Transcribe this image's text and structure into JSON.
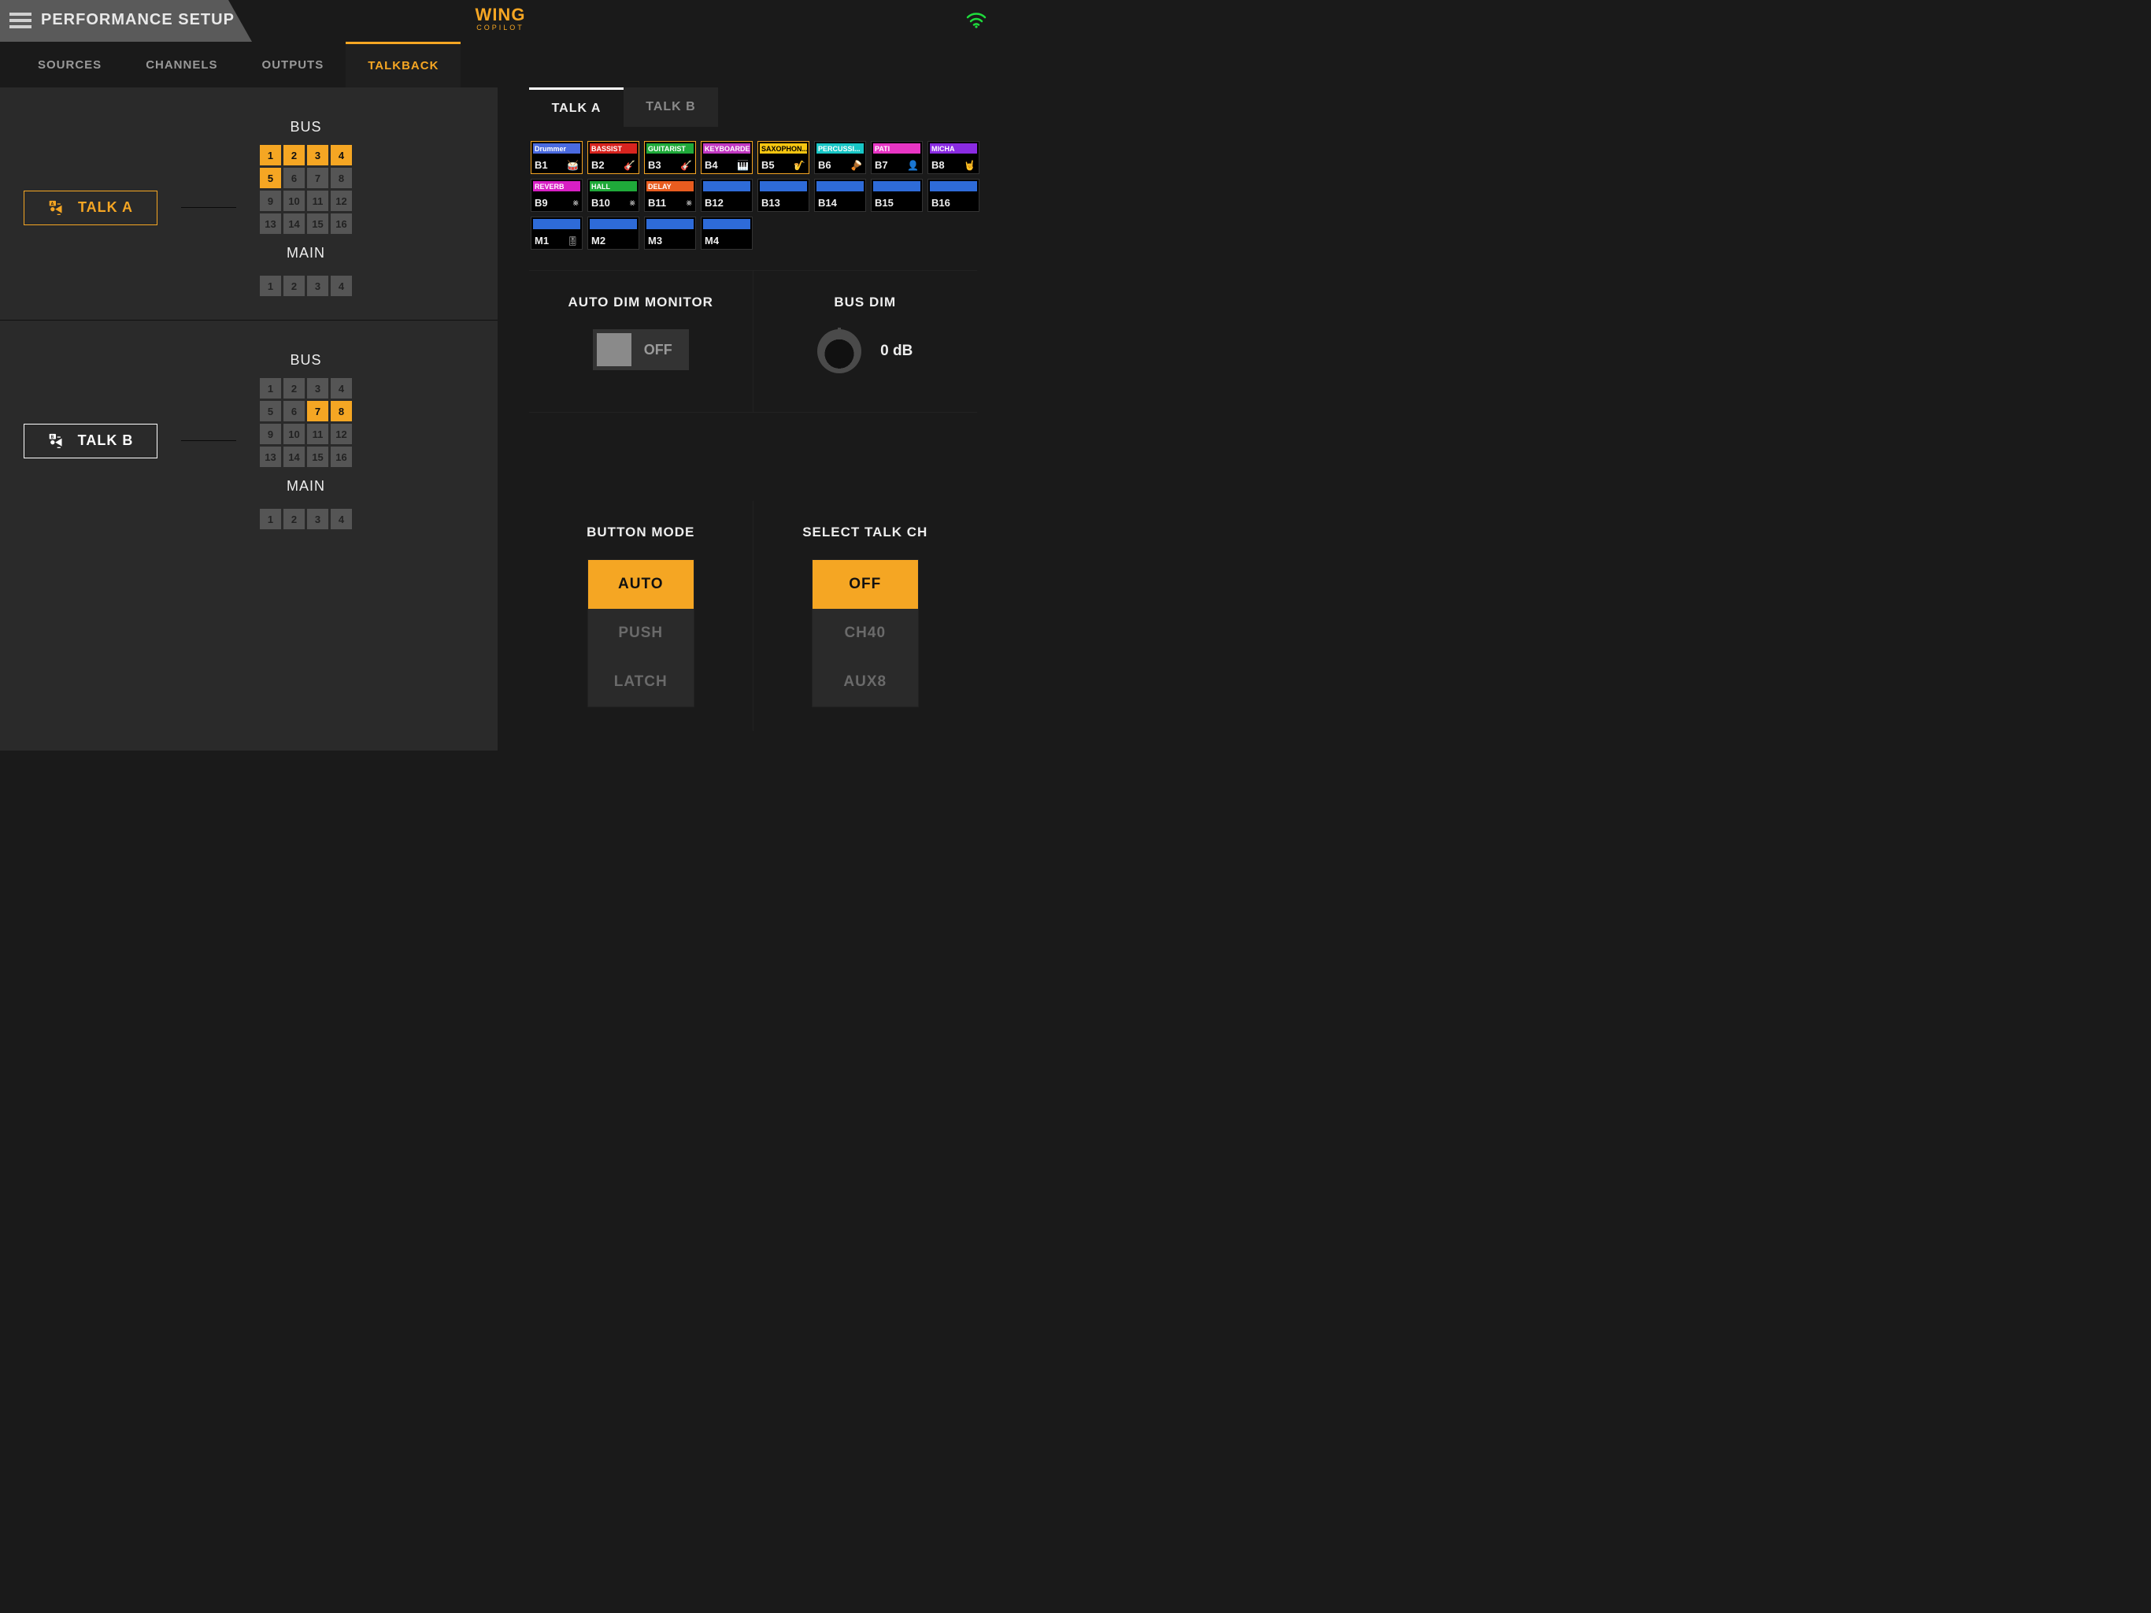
{
  "header": {
    "page_title": "PERFORMANCE SETUP",
    "logo_main": "WING",
    "logo_sub": "COPILOT"
  },
  "tabs": [
    "SOURCES",
    "CHANNELS",
    "OUTPUTS",
    "TALKBACK"
  ],
  "active_tab": 3,
  "left": {
    "sections": [
      {
        "button_label": "TALK A",
        "bus_label": "BUS",
        "main_label": "MAIN",
        "bus_on": [
          1,
          2,
          3,
          4,
          5
        ],
        "main_on": []
      },
      {
        "button_label": "TALK B",
        "bus_label": "BUS",
        "main_label": "MAIN",
        "bus_on": [
          7,
          8
        ],
        "main_on": []
      }
    ],
    "bus_numbers": [
      "1",
      "2",
      "3",
      "4",
      "5",
      "6",
      "7",
      "8",
      "9",
      "10",
      "11",
      "12",
      "13",
      "14",
      "15",
      "16"
    ],
    "main_numbers": [
      "1",
      "2",
      "3",
      "4"
    ]
  },
  "right": {
    "subtabs": [
      "TALK A",
      "TALK B"
    ],
    "active_subtab": 0,
    "buses": [
      {
        "id": "B1",
        "label": "Drummer",
        "color": "#4a6adf",
        "sel": true,
        "icon": "drum"
      },
      {
        "id": "B2",
        "label": "BASSIST",
        "color": "#d8241f",
        "sel": true,
        "icon": "guitar"
      },
      {
        "id": "B3",
        "label": "GUITARIST",
        "color": "#1faa3a",
        "sel": true,
        "icon": "guitar"
      },
      {
        "id": "B4",
        "label": "KEYBOARDER",
        "color": "#c238c2",
        "sel": true,
        "icon": "keys"
      },
      {
        "id": "B5",
        "label": "SAXOPHON...",
        "color": "#f5c511",
        "sel": true,
        "icon": "sax",
        "labeltext": "#000"
      },
      {
        "id": "B6",
        "label": "PERCUSSI...",
        "color": "#18c6c6",
        "sel": false,
        "icon": "perc"
      },
      {
        "id": "B7",
        "label": "PATI",
        "color": "#e835c4",
        "sel": false,
        "icon": "person"
      },
      {
        "id": "B8",
        "label": "MICHA",
        "color": "#8a2be2",
        "sel": false,
        "icon": "rock"
      },
      {
        "id": "B9",
        "label": "REVERB",
        "color": "#d81fc4",
        "sel": false,
        "icon": "fx"
      },
      {
        "id": "B10",
        "label": "HALL",
        "color": "#1faa3a",
        "sel": false,
        "icon": "fx"
      },
      {
        "id": "B11",
        "label": "DELAY",
        "color": "#e85c1f",
        "sel": false,
        "icon": "fx"
      },
      {
        "id": "B12",
        "label": "",
        "color": "#2e6bd8",
        "sel": false
      },
      {
        "id": "B13",
        "label": "",
        "color": "#2e6bd8",
        "sel": false
      },
      {
        "id": "B14",
        "label": "",
        "color": "#2e6bd8",
        "sel": false
      },
      {
        "id": "B15",
        "label": "",
        "color": "#2e6bd8",
        "sel": false
      },
      {
        "id": "B16",
        "label": "",
        "color": "#2e6bd8",
        "sel": false
      },
      {
        "id": "M1",
        "label": "",
        "color": "#2e6bd8",
        "sel": false,
        "icon": "sliders"
      },
      {
        "id": "M2",
        "label": "",
        "color": "#2e6bd8",
        "sel": false
      },
      {
        "id": "M3",
        "label": "",
        "color": "#2e6bd8",
        "sel": false
      },
      {
        "id": "M4",
        "label": "",
        "color": "#2e6bd8",
        "sel": false
      }
    ],
    "auto_dim": {
      "title": "AUTO DIM MONITOR",
      "state": "OFF"
    },
    "bus_dim": {
      "title": "BUS DIM",
      "value": "0 dB"
    },
    "button_mode": {
      "title": "BUTTON MODE",
      "options": [
        "AUTO",
        "PUSH",
        "LATCH"
      ],
      "selected": 0
    },
    "select_talk_ch": {
      "title": "SELECT TALK CH",
      "options": [
        "OFF",
        "CH40",
        "AUX8"
      ],
      "selected": 0
    }
  }
}
